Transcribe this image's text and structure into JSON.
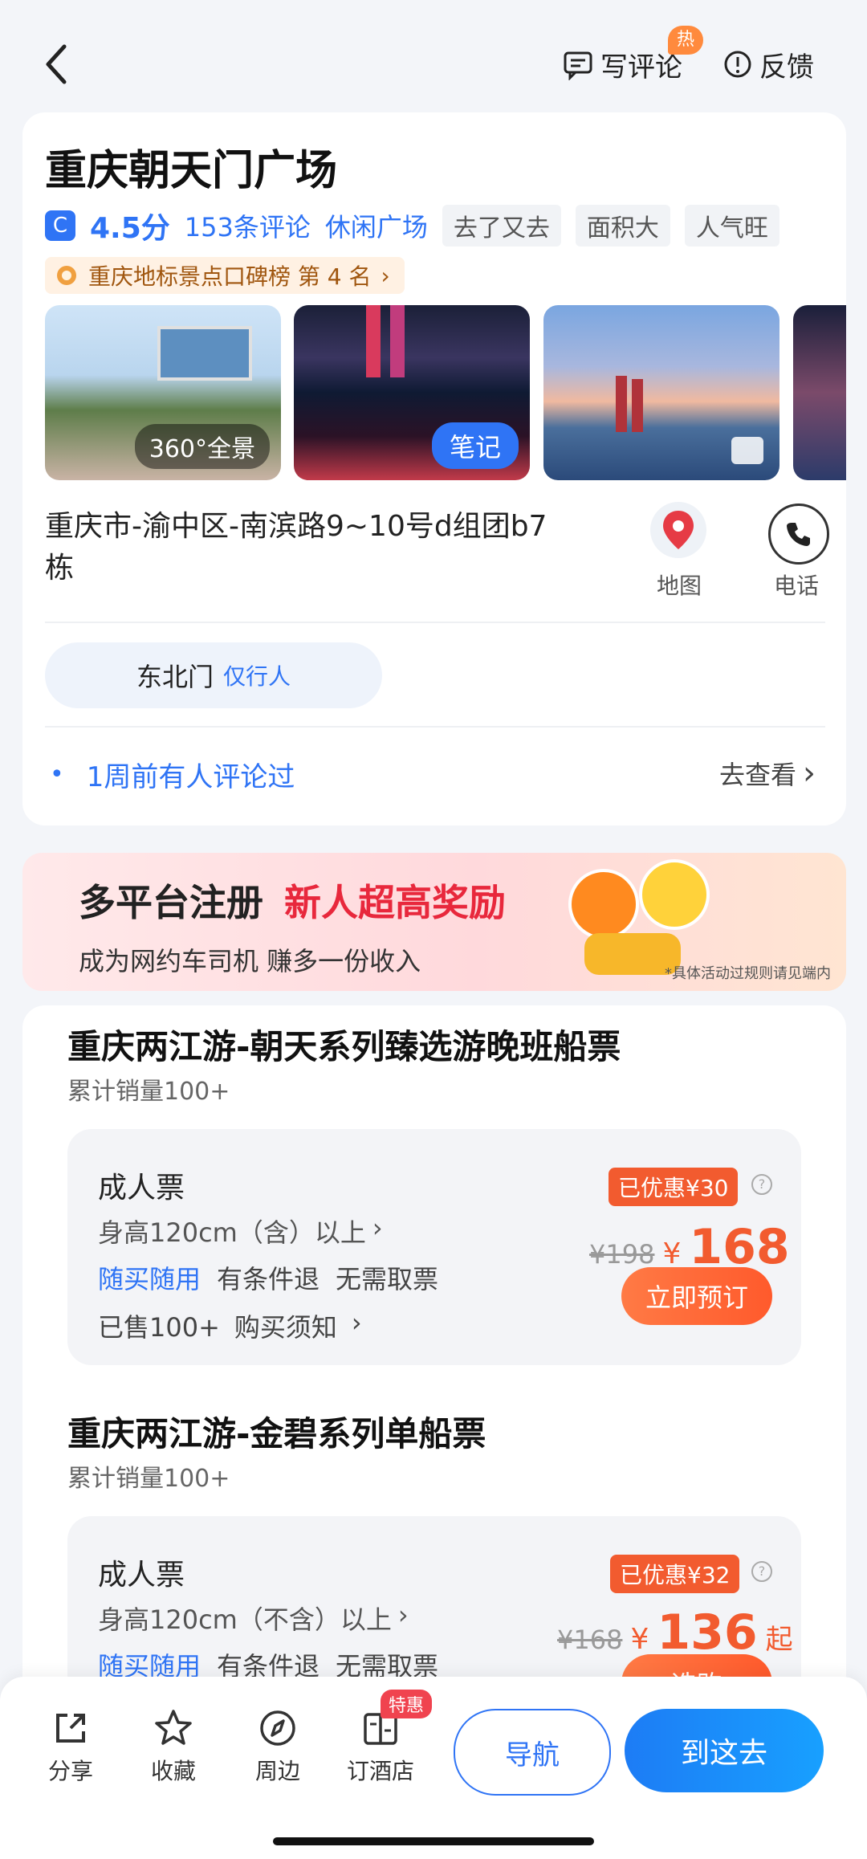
{
  "header": {
    "write_review": "写评论",
    "hot_badge": "热",
    "feedback": "反馈"
  },
  "poi": {
    "name": "重庆朝天门广场",
    "score": "4.5分",
    "reviews": "153条评论",
    "category": "休闲广场",
    "tags": [
      "去了又去",
      "面积大",
      "人气旺"
    ],
    "rank": "重庆地标景点口碑榜 第 4 名",
    "photos": [
      {
        "badge": "360°全景"
      },
      {
        "badge": "笔记"
      },
      {
        "badge": ""
      },
      {
        "badge": ""
      }
    ],
    "address": "重庆市-渝中区-南滨路9~10号d组团b7栋",
    "map_label": "地图",
    "phone_label": "电话",
    "gate": {
      "name": "东北门",
      "note": "仅行人"
    },
    "recent": "1周前有人评论过",
    "view_more": "去查看"
  },
  "banner": {
    "headline_black": "多平台注册",
    "headline_red": "新人超高奖励",
    "subtitle": "成为网约车司机 赚多一份收入",
    "footnote": "*具体活动过规则请见端内"
  },
  "products": [
    {
      "title": "重庆两江游-朝天系列臻选游晚班船票",
      "sales": "累计销量100+",
      "ticket": {
        "name": "成人票",
        "height_rule": "身高120cm（含）以上",
        "feature_blue": "随买随用",
        "features": [
          "有条件退",
          "无需取票"
        ],
        "sold": "已售100+",
        "notice": "购买须知",
        "discount": "已优惠¥30",
        "original_price": "¥198",
        "currency": "¥",
        "price": "168",
        "price_suffix": "",
        "button": "立即预订"
      }
    },
    {
      "title": "重庆两江游-金碧系列单船票",
      "sales": "累计销量100+",
      "ticket": {
        "name": "成人票",
        "height_rule": "身高120cm（不含）以上",
        "feature_blue": "随买随用",
        "features": [
          "有条件退",
          "无需取票"
        ],
        "discount": "已优惠¥32",
        "original_price": "¥168",
        "currency": "¥",
        "price": "136",
        "price_suffix": "起",
        "button": "选购"
      }
    }
  ],
  "bottom_bar": {
    "tabs": [
      {
        "label": "分享",
        "icon": "share-icon"
      },
      {
        "label": "收藏",
        "icon": "star-icon"
      },
      {
        "label": "周边",
        "icon": "compass-icon"
      },
      {
        "label": "订酒店",
        "icon": "hotel-icon",
        "badge": "特惠"
      }
    ],
    "navigate": "导航",
    "go_here": "到这去"
  }
}
